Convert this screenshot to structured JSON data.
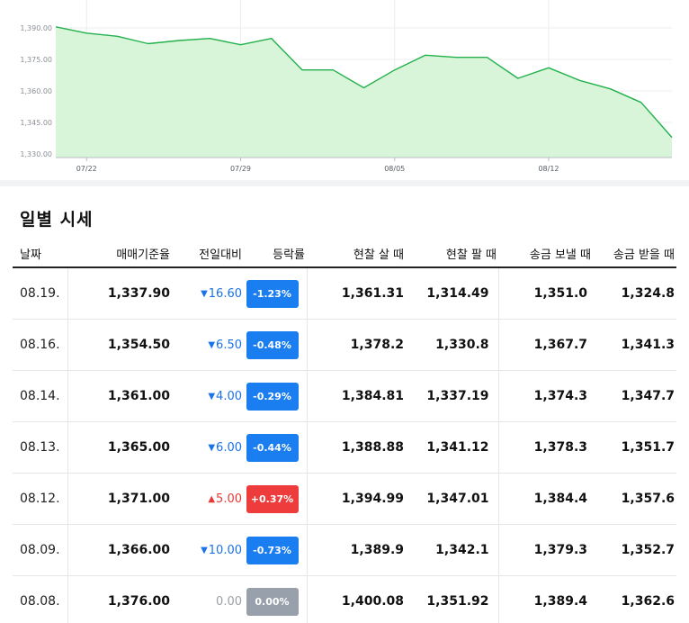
{
  "colors": {
    "line": "#22b14c",
    "fill": "#d8f5d9",
    "down": "#1a73e8",
    "up": "#e53935",
    "flat": "#98a0ab"
  },
  "chart_data": {
    "type": "area",
    "y_ticks": [
      "1,390.00",
      "1,375.00",
      "1,360.00",
      "1,345.00",
      "1,330.00"
    ],
    "x_ticks": [
      "07/22",
      "07/29",
      "08/05",
      "08/12"
    ],
    "ylim": [
      1330,
      1390
    ],
    "grid": true,
    "x": [
      "07/19",
      "07/22",
      "07/23",
      "07/24",
      "07/25",
      "07/26",
      "07/29",
      "07/30",
      "07/31",
      "08/01",
      "08/02",
      "08/05",
      "08/06",
      "08/07",
      "08/08",
      "08/09",
      "08/12",
      "08/13",
      "08/14",
      "08/16",
      "08/19"
    ],
    "values": [
      1390.5,
      1387.5,
      1386.0,
      1382.5,
      1384.0,
      1385.0,
      1382.0,
      1385.0,
      1370.0,
      1370.0,
      1361.5,
      1370.0,
      1377.0,
      1376.0,
      1376.0,
      1366.0,
      1371.0,
      1365.0,
      1361.0,
      1354.5,
      1337.9
    ]
  },
  "daily": {
    "title": "일별 시세",
    "headers": {
      "date": "날짜",
      "base": "매매기준율",
      "change": "전일대비",
      "rate": "등락률",
      "cash_buy": "현찰 살 때",
      "cash_sell": "현찰 팔 때",
      "send": "송금 보낼 때",
      "receive": "송금 받을 때"
    },
    "rows": [
      {
        "date": "08.19.",
        "base": "1,337.90",
        "dir": "down",
        "change": "16.60",
        "rate": "-1.23%",
        "cash_buy": "1,361.31",
        "cash_sell": "1,314.49",
        "send": "1,351.0",
        "receive": "1,324.8"
      },
      {
        "date": "08.16.",
        "base": "1,354.50",
        "dir": "down",
        "change": "6.50",
        "rate": "-0.48%",
        "cash_buy": "1,378.2",
        "cash_sell": "1,330.8",
        "send": "1,367.7",
        "receive": "1,341.3"
      },
      {
        "date": "08.14.",
        "base": "1,361.00",
        "dir": "down",
        "change": "4.00",
        "rate": "-0.29%",
        "cash_buy": "1,384.81",
        "cash_sell": "1,337.19",
        "send": "1,374.3",
        "receive": "1,347.7"
      },
      {
        "date": "08.13.",
        "base": "1,365.00",
        "dir": "down",
        "change": "6.00",
        "rate": "-0.44%",
        "cash_buy": "1,388.88",
        "cash_sell": "1,341.12",
        "send": "1,378.3",
        "receive": "1,351.7"
      },
      {
        "date": "08.12.",
        "base": "1,371.00",
        "dir": "up",
        "change": "5.00",
        "rate": "+0.37%",
        "cash_buy": "1,394.99",
        "cash_sell": "1,347.01",
        "send": "1,384.4",
        "receive": "1,357.6"
      },
      {
        "date": "08.09.",
        "base": "1,366.00",
        "dir": "down",
        "change": "10.00",
        "rate": "-0.73%",
        "cash_buy": "1,389.9",
        "cash_sell": "1,342.1",
        "send": "1,379.3",
        "receive": "1,352.7"
      },
      {
        "date": "08.08.",
        "base": "1,376.00",
        "dir": "flat",
        "change": "0.00",
        "rate": "0.00%",
        "cash_buy": "1,400.08",
        "cash_sell": "1,351.92",
        "send": "1,389.4",
        "receive": "1,362.6"
      }
    ]
  }
}
